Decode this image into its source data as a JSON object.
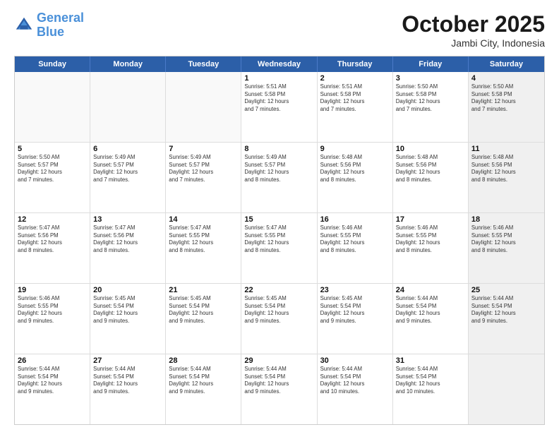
{
  "logo": {
    "line1": "General",
    "line2": "Blue"
  },
  "title": "October 2025",
  "subtitle": "Jambi City, Indonesia",
  "header_days": [
    "Sunday",
    "Monday",
    "Tuesday",
    "Wednesday",
    "Thursday",
    "Friday",
    "Saturday"
  ],
  "rows": [
    [
      {
        "day": "",
        "info": "",
        "empty": true
      },
      {
        "day": "",
        "info": "",
        "empty": true
      },
      {
        "day": "",
        "info": "",
        "empty": true
      },
      {
        "day": "1",
        "info": "Sunrise: 5:51 AM\nSunset: 5:58 PM\nDaylight: 12 hours\nand 7 minutes."
      },
      {
        "day": "2",
        "info": "Sunrise: 5:51 AM\nSunset: 5:58 PM\nDaylight: 12 hours\nand 7 minutes."
      },
      {
        "day": "3",
        "info": "Sunrise: 5:50 AM\nSunset: 5:58 PM\nDaylight: 12 hours\nand 7 minutes."
      },
      {
        "day": "4",
        "info": "Sunrise: 5:50 AM\nSunset: 5:58 PM\nDaylight: 12 hours\nand 7 minutes.",
        "shaded": true
      }
    ],
    [
      {
        "day": "5",
        "info": "Sunrise: 5:50 AM\nSunset: 5:57 PM\nDaylight: 12 hours\nand 7 minutes."
      },
      {
        "day": "6",
        "info": "Sunrise: 5:49 AM\nSunset: 5:57 PM\nDaylight: 12 hours\nand 7 minutes."
      },
      {
        "day": "7",
        "info": "Sunrise: 5:49 AM\nSunset: 5:57 PM\nDaylight: 12 hours\nand 7 minutes."
      },
      {
        "day": "8",
        "info": "Sunrise: 5:49 AM\nSunset: 5:57 PM\nDaylight: 12 hours\nand 8 minutes."
      },
      {
        "day": "9",
        "info": "Sunrise: 5:48 AM\nSunset: 5:56 PM\nDaylight: 12 hours\nand 8 minutes."
      },
      {
        "day": "10",
        "info": "Sunrise: 5:48 AM\nSunset: 5:56 PM\nDaylight: 12 hours\nand 8 minutes."
      },
      {
        "day": "11",
        "info": "Sunrise: 5:48 AM\nSunset: 5:56 PM\nDaylight: 12 hours\nand 8 minutes.",
        "shaded": true
      }
    ],
    [
      {
        "day": "12",
        "info": "Sunrise: 5:47 AM\nSunset: 5:56 PM\nDaylight: 12 hours\nand 8 minutes."
      },
      {
        "day": "13",
        "info": "Sunrise: 5:47 AM\nSunset: 5:56 PM\nDaylight: 12 hours\nand 8 minutes."
      },
      {
        "day": "14",
        "info": "Sunrise: 5:47 AM\nSunset: 5:55 PM\nDaylight: 12 hours\nand 8 minutes."
      },
      {
        "day": "15",
        "info": "Sunrise: 5:47 AM\nSunset: 5:55 PM\nDaylight: 12 hours\nand 8 minutes."
      },
      {
        "day": "16",
        "info": "Sunrise: 5:46 AM\nSunset: 5:55 PM\nDaylight: 12 hours\nand 8 minutes."
      },
      {
        "day": "17",
        "info": "Sunrise: 5:46 AM\nSunset: 5:55 PM\nDaylight: 12 hours\nand 8 minutes."
      },
      {
        "day": "18",
        "info": "Sunrise: 5:46 AM\nSunset: 5:55 PM\nDaylight: 12 hours\nand 8 minutes.",
        "shaded": true
      }
    ],
    [
      {
        "day": "19",
        "info": "Sunrise: 5:46 AM\nSunset: 5:55 PM\nDaylight: 12 hours\nand 9 minutes."
      },
      {
        "day": "20",
        "info": "Sunrise: 5:45 AM\nSunset: 5:54 PM\nDaylight: 12 hours\nand 9 minutes."
      },
      {
        "day": "21",
        "info": "Sunrise: 5:45 AM\nSunset: 5:54 PM\nDaylight: 12 hours\nand 9 minutes."
      },
      {
        "day": "22",
        "info": "Sunrise: 5:45 AM\nSunset: 5:54 PM\nDaylight: 12 hours\nand 9 minutes."
      },
      {
        "day": "23",
        "info": "Sunrise: 5:45 AM\nSunset: 5:54 PM\nDaylight: 12 hours\nand 9 minutes."
      },
      {
        "day": "24",
        "info": "Sunrise: 5:44 AM\nSunset: 5:54 PM\nDaylight: 12 hours\nand 9 minutes."
      },
      {
        "day": "25",
        "info": "Sunrise: 5:44 AM\nSunset: 5:54 PM\nDaylight: 12 hours\nand 9 minutes.",
        "shaded": true
      }
    ],
    [
      {
        "day": "26",
        "info": "Sunrise: 5:44 AM\nSunset: 5:54 PM\nDaylight: 12 hours\nand 9 minutes."
      },
      {
        "day": "27",
        "info": "Sunrise: 5:44 AM\nSunset: 5:54 PM\nDaylight: 12 hours\nand 9 minutes."
      },
      {
        "day": "28",
        "info": "Sunrise: 5:44 AM\nSunset: 5:54 PM\nDaylight: 12 hours\nand 9 minutes."
      },
      {
        "day": "29",
        "info": "Sunrise: 5:44 AM\nSunset: 5:54 PM\nDaylight: 12 hours\nand 9 minutes."
      },
      {
        "day": "30",
        "info": "Sunrise: 5:44 AM\nSunset: 5:54 PM\nDaylight: 12 hours\nand 10 minutes."
      },
      {
        "day": "31",
        "info": "Sunrise: 5:44 AM\nSunset: 5:54 PM\nDaylight: 12 hours\nand 10 minutes."
      },
      {
        "day": "",
        "info": "",
        "empty": true,
        "shaded": true
      }
    ]
  ]
}
